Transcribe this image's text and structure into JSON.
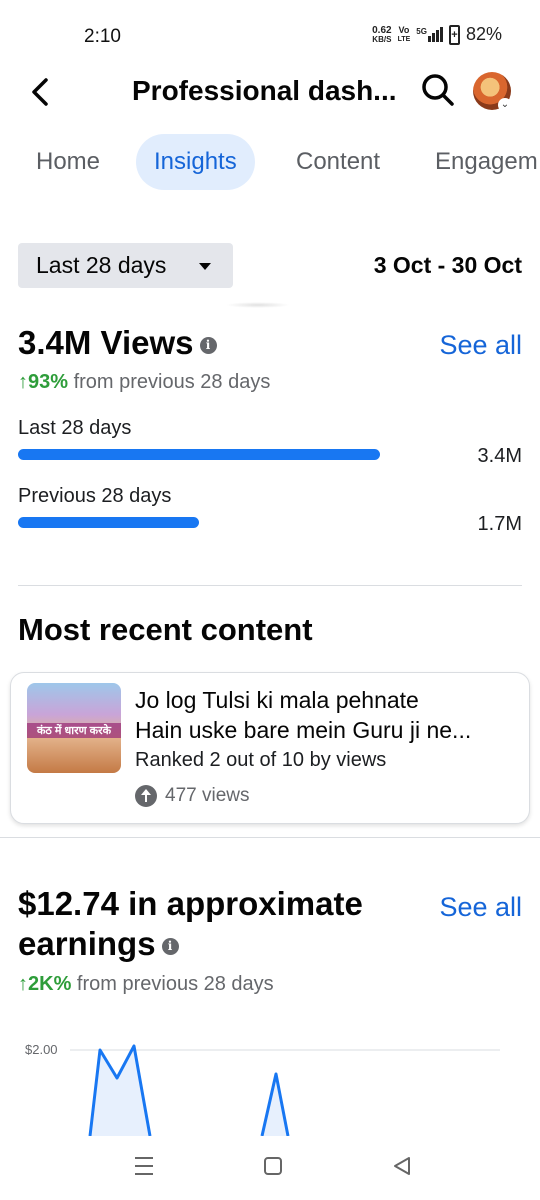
{
  "status": {
    "time": "2:10",
    "net_speed": "0.62",
    "net_unit": "KB/S",
    "volte_top": "Vo",
    "volte_bottom": "LTE",
    "network": "5G",
    "battery": "82%"
  },
  "header": {
    "title": "Professional dash..."
  },
  "tabs": [
    {
      "label": "Home"
    },
    {
      "label": "Insights"
    },
    {
      "label": "Content"
    },
    {
      "label": "Engagem"
    }
  ],
  "filter": {
    "selected": "Last 28 days",
    "date_range": "3 Oct - 30 Oct"
  },
  "views": {
    "title": "3.4M Views",
    "see_all": "See all",
    "change_value": "↑93%",
    "change_text": " from previous 28 days",
    "rows": [
      {
        "label": "Last 28 days",
        "value": "3.4M",
        "fraction": 1.0
      },
      {
        "label": "Previous 28 days",
        "value": "1.7M",
        "fraction": 0.5
      }
    ]
  },
  "recent": {
    "title": "Most recent content",
    "item": {
      "thumb_caption": "कंठ में धारण करके",
      "title_line1": "Jo log Tulsi ki mala pehnate",
      "title_line2": "Hain uske bare mein Guru ji ne...",
      "rank": "Ranked 2 out of 10 by views",
      "views": "477 views"
    }
  },
  "earnings": {
    "title_line1": "$12.74 in approximate",
    "title_line2": "earnings",
    "see_all": "See all",
    "change_value": "↑2K%",
    "change_text": " from previous 28 days"
  },
  "chart_data": {
    "type": "area",
    "y_tick_labels": [
      "$2.00"
    ],
    "grid": true,
    "colors": {
      "line": "#1877f2",
      "fill": "#e7f0fd"
    }
  },
  "colors": {
    "accent": "#1565d8",
    "bar": "#1877f2",
    "positive": "#2e9d3a"
  }
}
